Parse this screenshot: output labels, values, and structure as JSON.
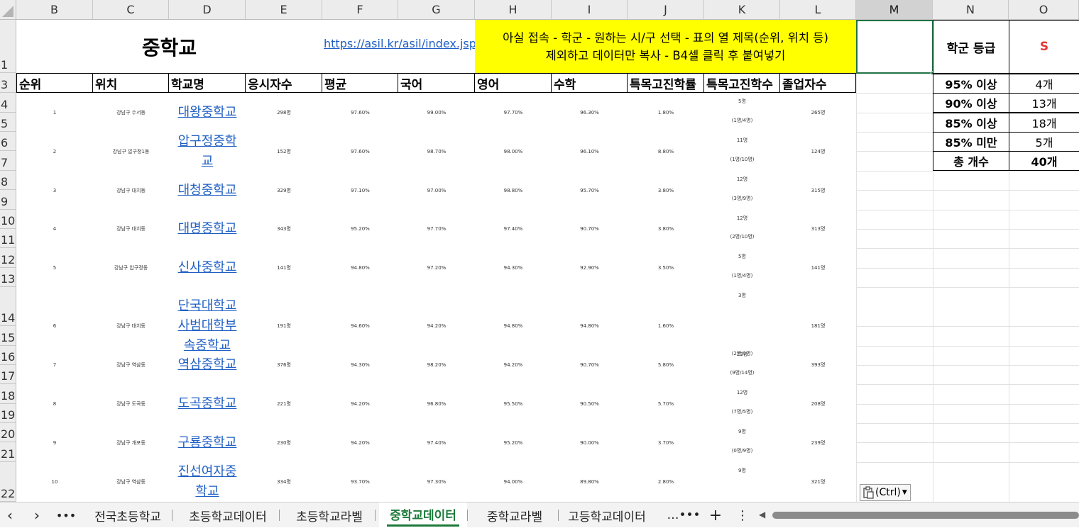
{
  "columns": [
    "B",
    "C",
    "D",
    "E",
    "F",
    "G",
    "H",
    "I",
    "J",
    "K",
    "L",
    "M",
    "N",
    "O"
  ],
  "row_numbers": [
    "1",
    "3",
    "4",
    "5",
    "6",
    "7",
    "8",
    "9",
    "10",
    "11",
    "12",
    "13",
    "14",
    "15",
    "16",
    "17",
    "18",
    "19",
    "20",
    "21",
    "22"
  ],
  "title": "중학교",
  "url": "https://asil.kr/asil/index.jsp",
  "instruction": {
    "line1": "아실 접속 - 학군 - 원하는 시/구 선택 - 표의 열 제목(순위, 위치 등)",
    "line2": "제외하고 데이터만 복사 - B4셀 클릭 후 붙여넣기"
  },
  "headers": [
    "순위",
    "위치",
    "학교명",
    "응시자수",
    "평균",
    "국어",
    "영어",
    "수학",
    "특목고진학률",
    "특목고진학수",
    "졸업자수"
  ],
  "rows": [
    {
      "rank": "1",
      "location": "강남구 수서동",
      "school": "대왕중학교",
      "examinees": "298명",
      "avg": "97.60%",
      "korean": "99.00%",
      "english": "97.70%",
      "math": "96.30%",
      "rate": "1.80%",
      "count": "5명",
      "count_detail": "(1명/4명)",
      "grads": "265명"
    },
    {
      "rank": "2",
      "location": "강남구 압구정1동",
      "school": "압구정중학교",
      "examinees": "152명",
      "avg": "97.60%",
      "korean": "98.70%",
      "english": "98.00%",
      "math": "96.10%",
      "rate": "8.80%",
      "count": "11명",
      "count_detail": "(1명/10명)",
      "grads": "124명"
    },
    {
      "rank": "3",
      "location": "강남구 대치동",
      "school": "대청중학교",
      "examinees": "329명",
      "avg": "97.10%",
      "korean": "97.00%",
      "english": "98.80%",
      "math": "95.70%",
      "rate": "3.80%",
      "count": "12명",
      "count_detail": "(3명/9명)",
      "grads": "315명"
    },
    {
      "rank": "4",
      "location": "강남구 대치동",
      "school": "대명중학교",
      "examinees": "343명",
      "avg": "95.20%",
      "korean": "97.70%",
      "english": "97.40%",
      "math": "90.70%",
      "rate": "3.80%",
      "count": "12명",
      "count_detail": "(2명/10명)",
      "grads": "313명"
    },
    {
      "rank": "5",
      "location": "강남구 압구정동",
      "school": "신사중학교",
      "examinees": "141명",
      "avg": "94.80%",
      "korean": "97.20%",
      "english": "94.30%",
      "math": "92.90%",
      "rate": "3.50%",
      "count": "5명",
      "count_detail": "(1명/4명)",
      "grads": "141명"
    },
    {
      "rank": "6",
      "location": "강남구 대치동",
      "school": "단국대학교사범대학부속중학교",
      "examinees": "191명",
      "avg": "94.60%",
      "korean": "94.20%",
      "english": "94.80%",
      "math": "94.80%",
      "rate": "1.60%",
      "count": "3명",
      "count_detail": "(2명/1명)",
      "grads": "181명"
    },
    {
      "rank": "7",
      "location": "강남구 역삼동",
      "school": "역삼중학교",
      "examinees": "376명",
      "avg": "94.30%",
      "korean": "98.20%",
      "english": "94.20%",
      "math": "90.70%",
      "rate": "5.80%",
      "count": "23명",
      "count_detail": "(9명/14명)",
      "grads": "393명"
    },
    {
      "rank": "8",
      "location": "강남구 도곡동",
      "school": "도곡중학교",
      "examinees": "221명",
      "avg": "94.20%",
      "korean": "96.80%",
      "english": "95.50%",
      "math": "90.50%",
      "rate": "5.70%",
      "count": "12명",
      "count_detail": "(7명/5명)",
      "grads": "208명"
    },
    {
      "rank": "9",
      "location": "강남구 개포동",
      "school": "구룡중학교",
      "examinees": "230명",
      "avg": "94.20%",
      "korean": "97.40%",
      "english": "95.20%",
      "math": "90.00%",
      "rate": "3.70%",
      "count": "9명",
      "count_detail": "(0명/9명)",
      "grads": "239명"
    },
    {
      "rank": "10",
      "location": "강남구 역삼동",
      "school": "진선여자중학교",
      "examinees": "334명",
      "avg": "93.70%",
      "korean": "97.30%",
      "english": "94.00%",
      "math": "89.80%",
      "rate": "2.80%",
      "count": "9명",
      "count_detail": "",
      "grads": "321명"
    }
  ],
  "grade_panel": {
    "label": "학군 등급",
    "grade": "S",
    "grade_color": "#e53935",
    "items": [
      {
        "label": "95% 이상",
        "value": "4개"
      },
      {
        "label": "90% 이상",
        "value": "13개"
      },
      {
        "label": "85% 이상",
        "value": "18개"
      },
      {
        "label": "85% 미만",
        "value": "5개"
      },
      {
        "label": "총 개수",
        "value": "40개"
      }
    ]
  },
  "paste_options": {
    "label": "(Ctrl)"
  },
  "sheet_tabs": {
    "items": [
      "전국초등학교",
      "초등학교데이터",
      "초등학교라벨",
      "중학교데이터",
      "중학교라벨",
      "고등학교데이터"
    ],
    "active": "중학교데이터",
    "active_color": "#1d7a3a",
    "more": "…",
    "add": "+"
  },
  "colors": {
    "instruction_bg": "#ffff00",
    "link": "#1f5fc4",
    "grid": "#e1e1e1"
  }
}
